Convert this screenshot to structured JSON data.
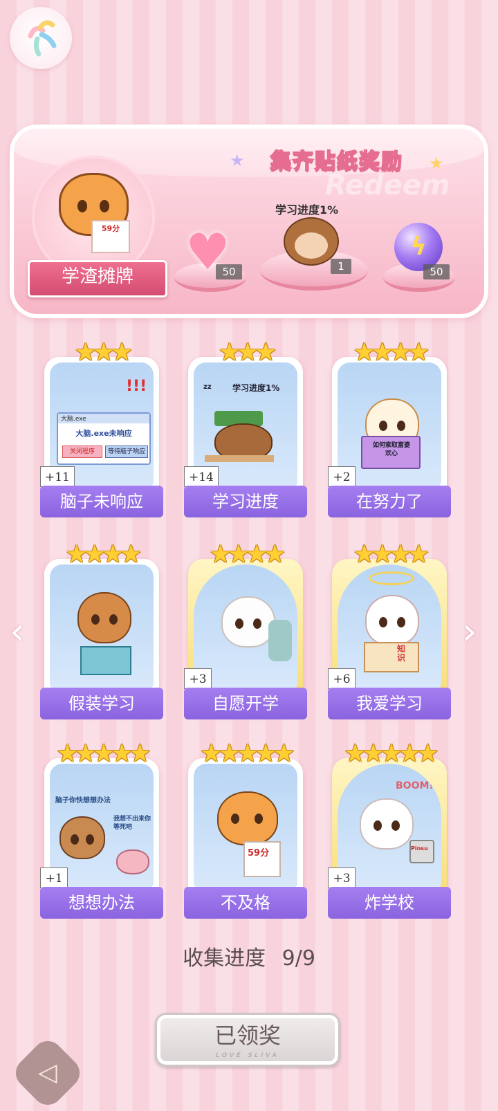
{
  "app": {
    "logo_icon": "app-logo-icon"
  },
  "reward_banner": {
    "title": "集齐贴纸奖励",
    "watermark": "Redeem",
    "sticker_paper_text": "59分",
    "set_name": "学渣摊牌",
    "rewards": [
      {
        "icon": "pink-heart-gem-icon",
        "count": "50"
      },
      {
        "icon": "monkey-sticker",
        "bubble": "学习进度1%",
        "count": "1"
      },
      {
        "icon": "purple-lightning-orb-icon",
        "count": "50"
      }
    ]
  },
  "stickers": [
    {
      "name": "脑子未响应",
      "stars": 3,
      "count": "+11",
      "art_texts": [
        "大脑.exe",
        "大脑.exe未响应",
        "关闭程序",
        "等待脑子响应"
      ]
    },
    {
      "name": "学习进度",
      "stars": 3,
      "count": "+14",
      "art_texts": [
        "学习进度1%",
        "zz"
      ]
    },
    {
      "name": "在努力了",
      "stars": 4,
      "count": "+2",
      "art_texts": [
        "如何索取富婆欢心"
      ]
    },
    {
      "name": "假装学习",
      "stars": 4,
      "count": "",
      "art_texts": []
    },
    {
      "name": "自愿开学",
      "stars": 4,
      "count": "+3",
      "art_texts": []
    },
    {
      "name": "我爱学习",
      "stars": 4,
      "count": "+6",
      "art_texts": [
        "知识"
      ]
    },
    {
      "name": "想想办法",
      "stars": 5,
      "count": "+1",
      "art_texts": [
        "脑子你快想想办法",
        "我想不出来你等死吧"
      ]
    },
    {
      "name": "不及格",
      "stars": 5,
      "count": "",
      "art_texts": [
        "59分"
      ]
    },
    {
      "name": "炸学校",
      "stars": 5,
      "count": "+3",
      "art_texts": [
        "BOOM!!",
        "Pinsu"
      ]
    }
  ],
  "progress": {
    "label": "收集进度",
    "value": "9/9"
  },
  "claim_button": {
    "label": "已领奖",
    "sub": "LOVE SLIVA"
  },
  "nav": {
    "prev_icon": "chevron-left-icon",
    "next_icon": "chevron-right-icon",
    "back_icon": "back-arrow-icon"
  }
}
